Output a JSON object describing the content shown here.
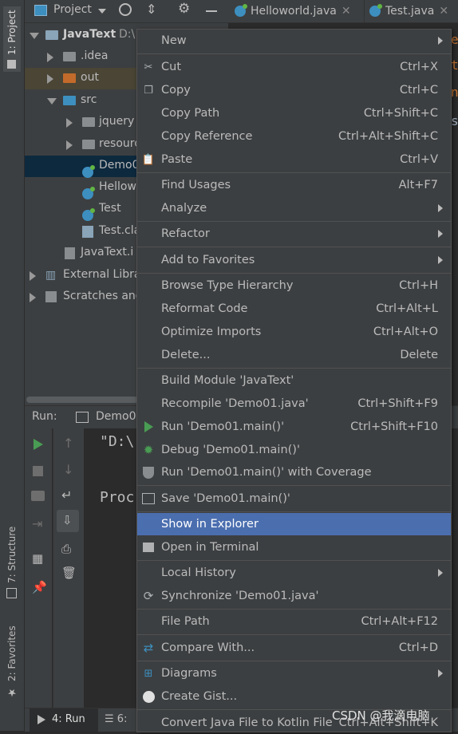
{
  "left_strip": {
    "project_tab": "1: Project",
    "structure_tab": "7: Structure",
    "favorites_tab": "2: Favorites"
  },
  "project_header": {
    "title": "Project"
  },
  "editor_tabs": [
    {
      "label": "Helloworld.java"
    },
    {
      "label": "Test.java"
    }
  ],
  "tree": {
    "root": "JavaText",
    "root_path": "D:\\",
    "idea": ".idea",
    "out": "out",
    "src": "src",
    "jquery": "jquery",
    "resources": "resourc",
    "demo": "Demo0",
    "hello": "Hellow",
    "test": "Test",
    "testclass": "Test.cla",
    "iml": "JavaText.i",
    "extlib": "External Libra",
    "scratches": "Scratches and"
  },
  "run_panel": {
    "label": "Run:",
    "tab": "Demo01",
    "console_line1": "\"D:\\",
    "console_line2": "Proc"
  },
  "bottom_bar": {
    "run_tab": "4: Run",
    "todo_tab": "6:"
  },
  "editor_peek": [
    "e",
    "t",
    "n",
    "s"
  ],
  "menu": {
    "new": "New",
    "cut": "Cut",
    "cut_sc": "Ctrl+X",
    "copy": "Copy",
    "copy_sc": "Ctrl+C",
    "copy_path": "Copy Path",
    "copy_path_sc": "Ctrl+Shift+C",
    "copy_ref": "Copy Reference",
    "copy_ref_sc": "Ctrl+Alt+Shift+C",
    "paste": "Paste",
    "paste_sc": "Ctrl+V",
    "find_usages": "Find Usages",
    "find_usages_sc": "Alt+F7",
    "analyze": "Analyze",
    "refactor": "Refactor",
    "add_fav": "Add to Favorites",
    "browse_type": "Browse Type Hierarchy",
    "browse_type_sc": "Ctrl+H",
    "reformat": "Reformat Code",
    "reformat_sc": "Ctrl+Alt+L",
    "optimize": "Optimize Imports",
    "optimize_sc": "Ctrl+Alt+O",
    "delete": "Delete...",
    "delete_sc": "Delete",
    "build_module": "Build Module 'JavaText'",
    "recompile": "Recompile 'Demo01.java'",
    "recompile_sc": "Ctrl+Shift+F9",
    "run": "Run 'Demo01.main()'",
    "run_sc": "Ctrl+Shift+F10",
    "debug": "Debug 'Demo01.main()'",
    "coverage": "Run 'Demo01.main()' with Coverage",
    "save": "Save 'Demo01.main()'",
    "show_explorer": "Show in Explorer",
    "open_terminal": "Open in Terminal",
    "local_history": "Local History",
    "synchronize": "Synchronize 'Demo01.java'",
    "file_path": "File Path",
    "file_path_sc": "Ctrl+Alt+F12",
    "compare": "Compare With...",
    "compare_sc": "Ctrl+D",
    "diagrams": "Diagrams",
    "gist": "Create Gist...",
    "kotlin": "Convert Java File to Kotlin File",
    "kotlin_sc": "Ctrl+Alt+Shift+K"
  },
  "watermark": "CSDN @我滴电脑",
  "colors": {
    "selection": "#4b6eaf",
    "menu_bg": "#3c3f41",
    "run_green": "#499c54"
  }
}
